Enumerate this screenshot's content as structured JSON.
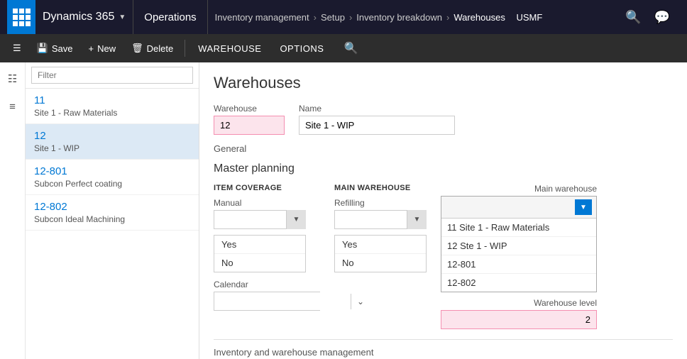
{
  "topNav": {
    "brand": "Dynamics 365",
    "module": "Operations",
    "breadcrumb": [
      "Inventory management",
      "Setup",
      "Inventory breakdown",
      "Warehouses",
      "USMF"
    ],
    "searchIcon": "🔍",
    "chatIcon": "💬"
  },
  "toolbar": {
    "saveLabel": "Save",
    "newLabel": "New",
    "deleteLabel": "Delete",
    "warehouseTab": "WAREHOUSE",
    "optionsTab": "OPTIONS",
    "searchPlaceholder": "Search"
  },
  "sidebar": {
    "filterPlaceholder": "Filter",
    "items": [
      {
        "id": "11",
        "name": "Site 1 - Raw Materials",
        "active": false
      },
      {
        "id": "12",
        "name": "Site 1 - WIP",
        "active": true
      },
      {
        "id": "12-801",
        "name": "Subcon Perfect coating",
        "active": false
      },
      {
        "id": "12-802",
        "name": "Subcon Ideal Machining",
        "active": false
      }
    ]
  },
  "content": {
    "pageTitle": "Warehouses",
    "warehouseLabel": "Warehouse",
    "warehouseValue": "12",
    "nameLabel": "Name",
    "nameValue": "Site 1 - WIP",
    "generalLabel": "General",
    "masterPlanningLabel": "Master planning",
    "itemCoverageLabel": "ITEM COVERAGE",
    "mainWarehouseLabel": "MAIN WAREHOUSE",
    "mainWarehouseRightLabel": "Main warehouse",
    "manualLabel": "Manual",
    "refillingLabel": "Refilling",
    "yesLabel": "Yes",
    "noLabel": "No",
    "calendarLabel": "Calendar",
    "warehouseLevelLabel": "Warehouse level",
    "warehouseLevelValue": "2",
    "inventoryLabel": "Inventory and warehouse management",
    "mainWarehouseOptions": [
      "11 Site 1 - Raw Materials",
      "12 Ste 1 - WIP",
      "12-801",
      "12-802"
    ]
  }
}
